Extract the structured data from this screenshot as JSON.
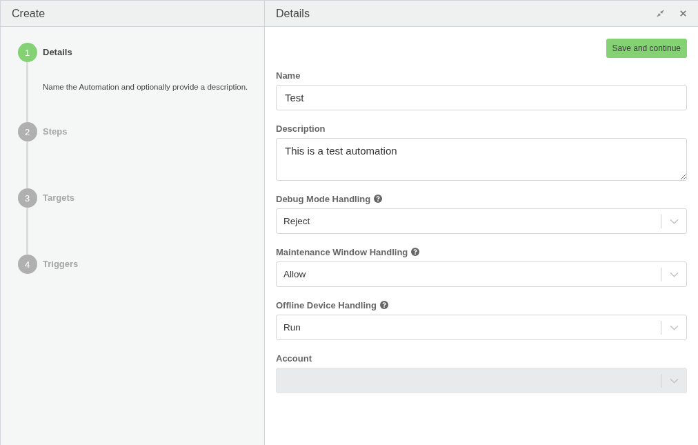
{
  "left_panel": {
    "title": "Create",
    "steps": [
      {
        "number": "1",
        "label": "Details",
        "selected": true,
        "description": "Name the Automation and optionally provide a description."
      },
      {
        "number": "2",
        "label": "Steps",
        "selected": false
      },
      {
        "number": "3",
        "label": "Targets",
        "selected": false
      },
      {
        "number": "4",
        "label": "Triggers",
        "selected": false
      }
    ]
  },
  "right_panel": {
    "title": "Details",
    "save_button": "Save and continue",
    "fields": [
      {
        "kind": "text",
        "label": "Name",
        "value": "Test",
        "help": false,
        "disabled": false
      },
      {
        "kind": "textarea",
        "label": "Description",
        "value": "This is a test automation",
        "help": false,
        "disabled": false
      },
      {
        "kind": "select",
        "label": "Debug Mode Handling",
        "value": "Reject",
        "help": true,
        "disabled": false
      },
      {
        "kind": "select",
        "label": "Maintenance Window Handling",
        "value": "Allow",
        "help": true,
        "disabled": false
      },
      {
        "kind": "select",
        "label": "Offline Device Handling",
        "value": "Run",
        "help": true,
        "disabled": false
      },
      {
        "kind": "select",
        "label": "Account",
        "help": false,
        "disabled": true
      }
    ]
  }
}
